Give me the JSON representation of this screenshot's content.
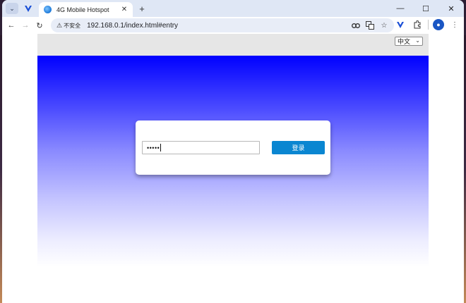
{
  "tab": {
    "title": "4G Mobile Hotspot",
    "close_glyph": "✕",
    "new_tab_glyph": "+"
  },
  "window_controls": {
    "minimize": "—",
    "maximize": "☐",
    "close": "✕"
  },
  "toolbar": {
    "back_glyph": "←",
    "forward_glyph": "→",
    "reload_glyph": "↻",
    "security_label": "不安全",
    "url": "192.168.0.1/index.html#entry"
  },
  "page": {
    "language_select": {
      "selected": "中文",
      "options": [
        "中文"
      ]
    },
    "login": {
      "password_value": "•••••",
      "button_label": "登录"
    }
  },
  "colors": {
    "accent_button": "#0a86d1",
    "hero_top": "#0000ff",
    "browser_chrome": "#dfe7f5"
  },
  "icons": [
    "tab-menu-icon",
    "vivaldi-icon",
    "favicon-icon",
    "password-key-icon",
    "translate-icon",
    "bookmark-star-icon",
    "extensions-icon",
    "profile-icon"
  ]
}
